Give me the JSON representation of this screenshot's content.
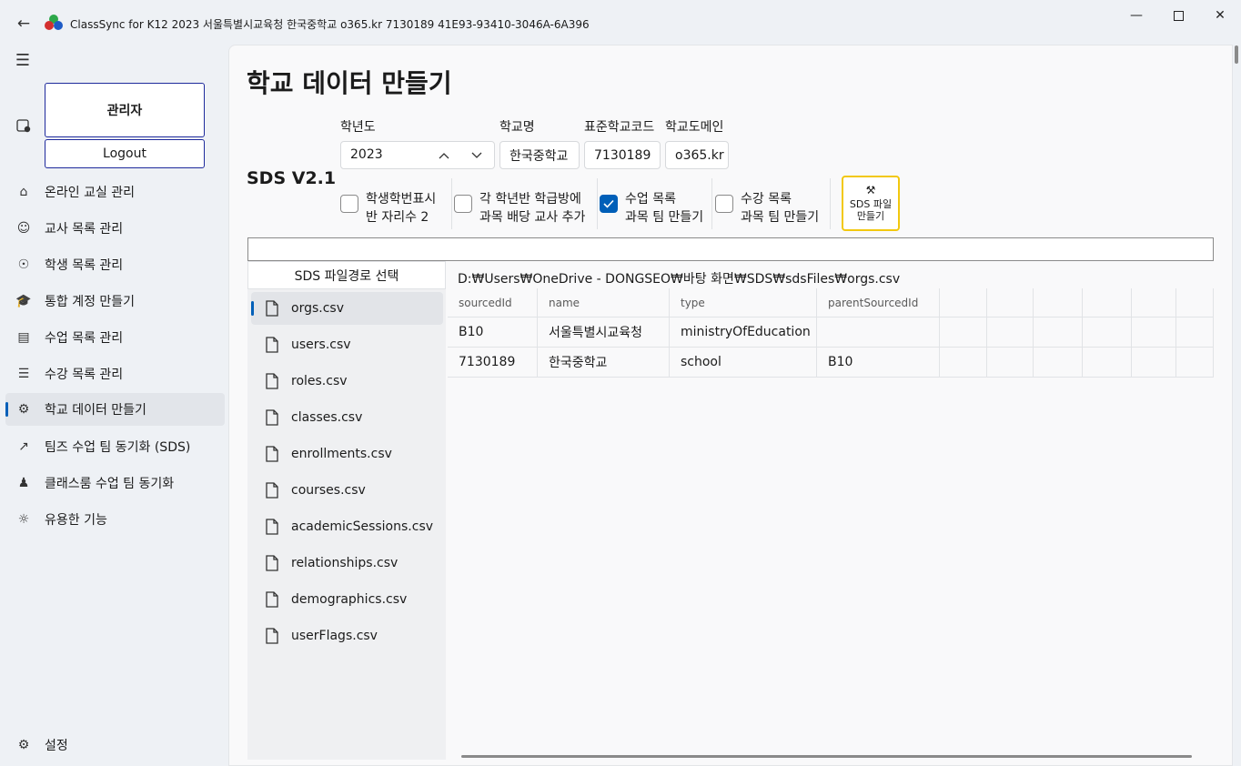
{
  "window": {
    "title": "ClassSync for K12 2023 서울특별시교육청 한국중학교 o365.kr 7130189 41E93-93410-3046A-6A396",
    "back_icon": "back-arrow-icon",
    "controls": [
      "minimize",
      "maximize",
      "close"
    ]
  },
  "sidebar": {
    "role": "관리자",
    "logout_label": "Logout",
    "items": [
      {
        "label": "온라인 교실 관리",
        "icon": "home-icon"
      },
      {
        "label": "교사 목록 관리",
        "icon": "teacher-icon"
      },
      {
        "label": "학생 목록 관리",
        "icon": "student-icon"
      },
      {
        "label": "통합 계정 만들기",
        "icon": "graduation-cap-icon"
      },
      {
        "label": "수업 목록 관리",
        "icon": "clipboard-icon"
      },
      {
        "label": "수강 목록 관리",
        "icon": "list-icon"
      },
      {
        "label": "학교 데이터 만들기",
        "icon": "gears-icon",
        "selected": true
      },
      {
        "label": "팀즈 수업 팀 동기화 (SDS)",
        "icon": "share-icon"
      },
      {
        "label": "클래스룸 수업 팀 동기화",
        "icon": "people-icon"
      },
      {
        "label": "유용한 기능",
        "icon": "lightbulb-icon"
      }
    ],
    "settings_label": "설정"
  },
  "page": {
    "title": "학교 데이터 만들기",
    "sds_version": "SDS V2.1",
    "fields": {
      "year_label": "학년도",
      "year_value": "2023",
      "school_name_label": "학교명",
      "school_name_value": "한국중학교",
      "school_code_label": "표준학교코드",
      "school_code_value": "7130189",
      "domain_label": "학교도메인",
      "domain_value": "o365.kr"
    },
    "options": [
      {
        "line1": "학생학번표시",
        "line2": "반 자리수 2",
        "checked": false
      },
      {
        "line1": "각 학년반 학급방에",
        "line2": "과목 배당 교사 추가",
        "checked": false
      },
      {
        "line1": "수업 목록",
        "line2": "과목 팀 만들기",
        "checked": true
      },
      {
        "line1": "수강 목록",
        "line2": "과목 팀 만들기",
        "checked": false
      }
    ],
    "make_button": {
      "line1": "SDS 파일",
      "line2": "만들기"
    },
    "path_input_value": "",
    "choose_path_label": "SDS 파일경로 선택",
    "current_path": "D:₩Users₩OneDrive - DONGSEO₩바탕 화면₩SDS₩sdsFiles₩orgs.csv",
    "files": [
      "orgs.csv",
      "users.csv",
      "roles.csv",
      "classes.csv",
      "enrollments.csv",
      "courses.csv",
      "academicSessions.csv",
      "relationships.csv",
      "demographics.csv",
      "userFlags.csv"
    ],
    "selected_file_index": 0,
    "table": {
      "columns": [
        "sourcedId",
        "name",
        "type",
        "parentSourcedId"
      ],
      "rows": [
        [
          "B10",
          "서울특별시교육청",
          "ministryOfEducation",
          ""
        ],
        [
          "7130189",
          "한국중학교",
          "school",
          "B10"
        ]
      ]
    }
  },
  "colors": {
    "accent": "#005fb8",
    "button_border": "#1e2a9c",
    "make_button_border": "#f2c80f"
  }
}
